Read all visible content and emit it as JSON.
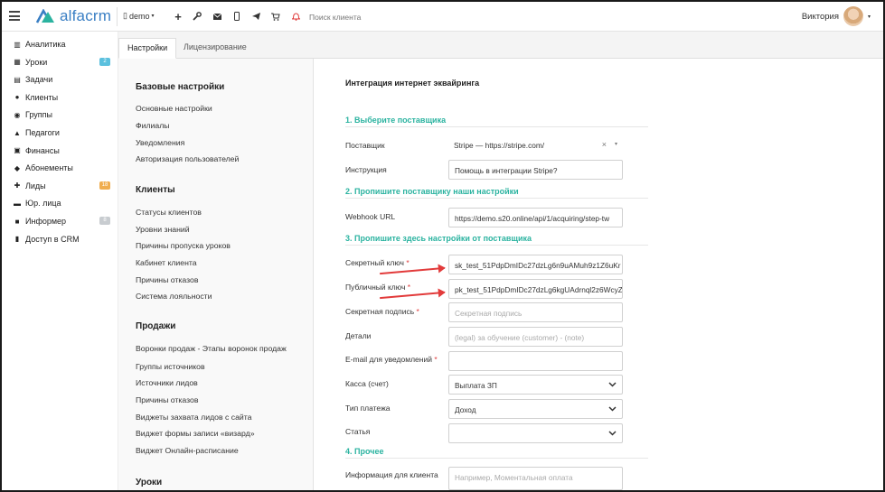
{
  "topbar": {
    "logo_text": "alfacrm",
    "demo_label": "demo",
    "search_placeholder": "Поиск клиента",
    "user_name": "Виктория"
  },
  "sidebar": {
    "items": [
      {
        "label": "Аналитика",
        "icon": "chart-icon"
      },
      {
        "label": "Уроки",
        "icon": "calendar-icon",
        "badge": "2",
        "badge_color": "#5bc0de"
      },
      {
        "label": "Задачи",
        "icon": "tasks-icon"
      },
      {
        "label": "Клиенты",
        "icon": "user-icon"
      },
      {
        "label": "Группы",
        "icon": "users-icon"
      },
      {
        "label": "Педагоги",
        "icon": "graduation-cap-icon"
      },
      {
        "label": "Финансы",
        "icon": "money-icon"
      },
      {
        "label": "Абонементы",
        "icon": "tag-icon"
      },
      {
        "label": "Лиды",
        "icon": "user-plus-icon",
        "badge": "18",
        "badge_color": "#f0ad4e"
      },
      {
        "label": "Юр. лица",
        "icon": "briefcase-icon"
      },
      {
        "label": "Информер",
        "icon": "monitor-icon",
        "badge": "8",
        "badge_color": "#c8ccd0"
      },
      {
        "label": "Доступ в CRM",
        "icon": "lock-icon"
      }
    ]
  },
  "tabs": [
    "Настройки",
    "Лицензирование"
  ],
  "settings_menu": {
    "groups": [
      {
        "title": "Базовые настройки",
        "items": [
          "Основные настройки",
          "Филиалы",
          "Уведомления",
          "Авторизация пользователей"
        ]
      },
      {
        "title": "Клиенты",
        "items": [
          "Статусы клиентов",
          "Уровни знаний",
          "Причины пропуска уроков",
          "Кабинет клиента",
          "Причины отказов",
          "Система лояльности"
        ]
      },
      {
        "title": "Продажи",
        "items": [
          "Воронки продаж - Этапы воронок продаж",
          "Группы источников",
          "Источники лидов",
          "Причины отказов",
          "Виджеты захвата лидов с сайта",
          "Виджет формы записи «визард»",
          "Виджет Онлайн-расписание"
        ]
      },
      {
        "title": "Уроки",
        "items": []
      }
    ]
  },
  "content": {
    "title": "Интеграция интернет эквайринга",
    "sections": [
      "1. Выберите поставщика",
      "2. Пропишите поставщику наши настройки",
      "3. Пропишите здесь настройки от поставщика",
      "4. Прочее"
    ],
    "fields": {
      "provider": {
        "label": "Поставщик",
        "value": "Stripe — https://stripe.com/"
      },
      "instruction": {
        "label": "Инструкция",
        "value": "Помощь в интеграции Stripe?"
      },
      "webhook": {
        "label": "Webhook URL",
        "value": "https://demo.s20.online/api/1/acquiring/step-tw"
      },
      "secret_key": {
        "label": "Секретный ключ",
        "required": "*",
        "value": "sk_test_51PdpDmIDc27dzLg6n9uAMuh9z1Z6uKr"
      },
      "public_key": {
        "label": "Публичный ключ",
        "required": "*",
        "value": "pk_test_51PdpDmIDc27dzLg6kgUAdrnql2z6WcyZ"
      },
      "secret_sign": {
        "label": "Секретная подпись",
        "required": "*",
        "placeholder": "Секретная подпись"
      },
      "details": {
        "label": "Детали",
        "placeholder": "(legal) за обучение (customer) - (note)"
      },
      "email": {
        "label": "E-mail для уведомлений",
        "required": "*",
        "value": ""
      },
      "cashbox": {
        "label": "Касса (счет)",
        "value": "Выплата ЗП"
      },
      "payment_type": {
        "label": "Тип платежа",
        "value": "Доход"
      },
      "article": {
        "label": "Статья",
        "value": ""
      },
      "client_info": {
        "label": "Информация для клиента",
        "placeholder": "Например, Моментальная оплата"
      }
    }
  },
  "colors": {
    "accent": "#2bb3a0",
    "brand": "#3a7fc4",
    "arrow": "#e23b3b"
  }
}
